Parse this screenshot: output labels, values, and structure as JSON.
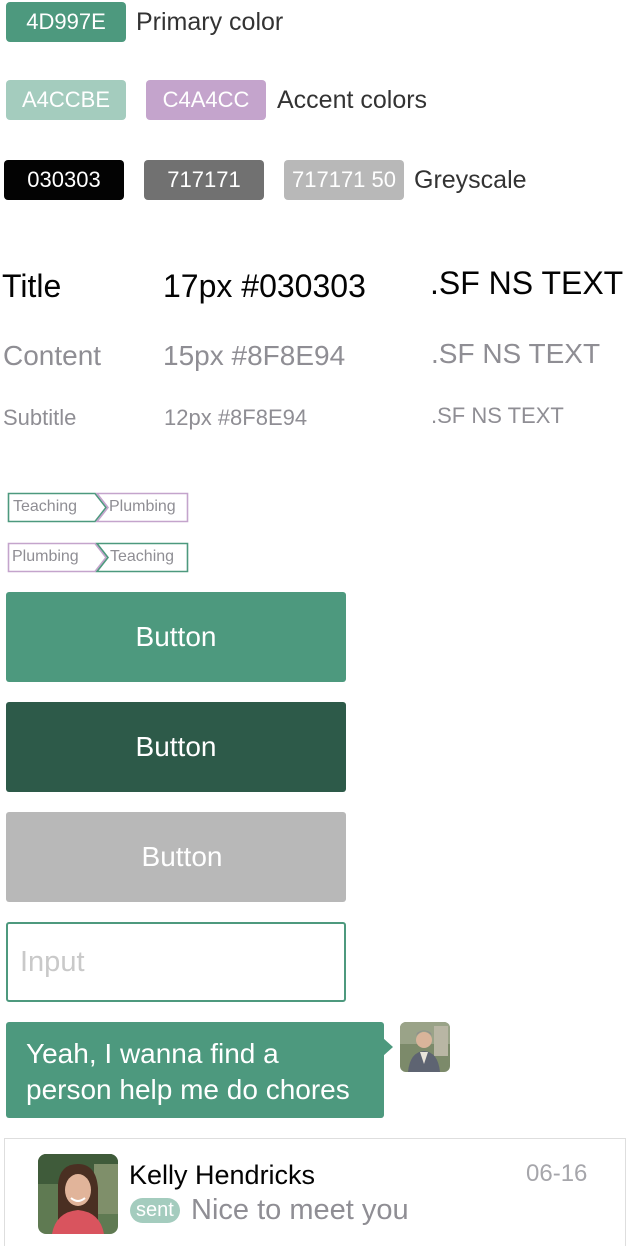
{
  "colors": {
    "primary": "#4D997E",
    "accent_green": "#A4CCBE",
    "accent_purple": "#C4A4CC",
    "black": "#030303",
    "grey": "#717171",
    "grey_50": "#B8B8B8",
    "button_dark": "#2D5A49",
    "text_secondary": "#8F8E94"
  },
  "swatches": {
    "primary": {
      "chip": "4D997E",
      "label": "Primary color"
    },
    "accent": {
      "chips": [
        "A4CCBE",
        "C4A4CC"
      ],
      "label": "Accent colors"
    },
    "greyscale": {
      "chips": [
        "030303",
        "717171",
        "717171 50"
      ],
      "label": "Greyscale"
    }
  },
  "typography": [
    {
      "name": "Title",
      "spec": "17px #030303",
      "font": ".SF NS TEXT"
    },
    {
      "name": "Content",
      "spec": "15px #8F8E94",
      "font": ".SF NS TEXT"
    },
    {
      "name": "Subtitle",
      "spec": "12px #8F8E94",
      "font": ".SF NS TEXT"
    }
  ],
  "tags": [
    {
      "left": "Teaching",
      "right": "Plumbing"
    },
    {
      "left": "Plumbing",
      "right": "Teaching"
    }
  ],
  "buttons": {
    "primary": "Button",
    "pressed": "Button",
    "disabled": "Button"
  },
  "input": {
    "placeholder": "Input",
    "value": ""
  },
  "chat": {
    "message_line1": "Yeah, I wanna find a",
    "message_line2": "person help me do chores"
  },
  "contact": {
    "name": "Kelly Hendricks",
    "date": "06-16",
    "badge": "sent",
    "message": "Nice to meet you"
  }
}
